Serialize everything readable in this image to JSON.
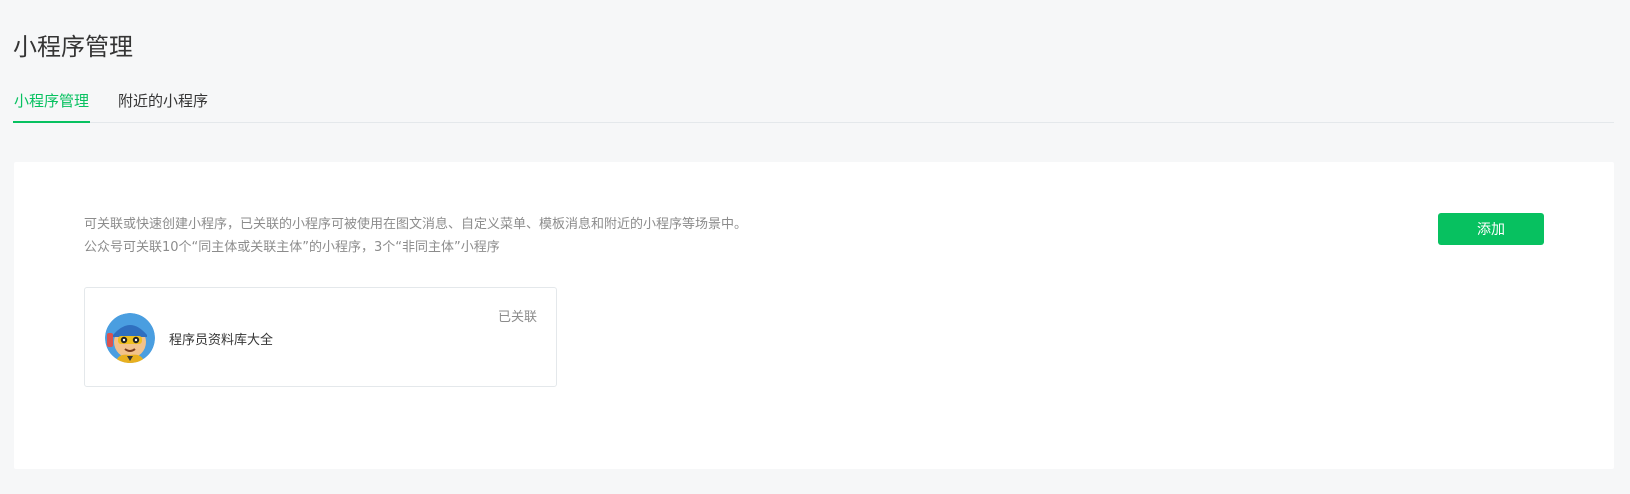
{
  "page": {
    "title": "小程序管理"
  },
  "tabs": [
    {
      "label": "小程序管理",
      "active": true
    },
    {
      "label": "附近的小程序",
      "active": false
    }
  ],
  "panel": {
    "description_line1": "可关联或快速创建小程序，已关联的小程序可被使用在图文消息、自定义菜单、模板消息和附近的小程序等场景中。",
    "description_line2": "公众号可关联10个“同主体或关联主体”的小程序，3个“非同主体”小程序",
    "add_label": "添加"
  },
  "mini_programs": [
    {
      "name": "程序员资料库大全",
      "status": "已关联",
      "avatar": "cartoon-avatar"
    }
  ],
  "colors": {
    "accent": "#07c160",
    "background": "#f6f7f8",
    "muted_text": "#8c8c8c"
  }
}
